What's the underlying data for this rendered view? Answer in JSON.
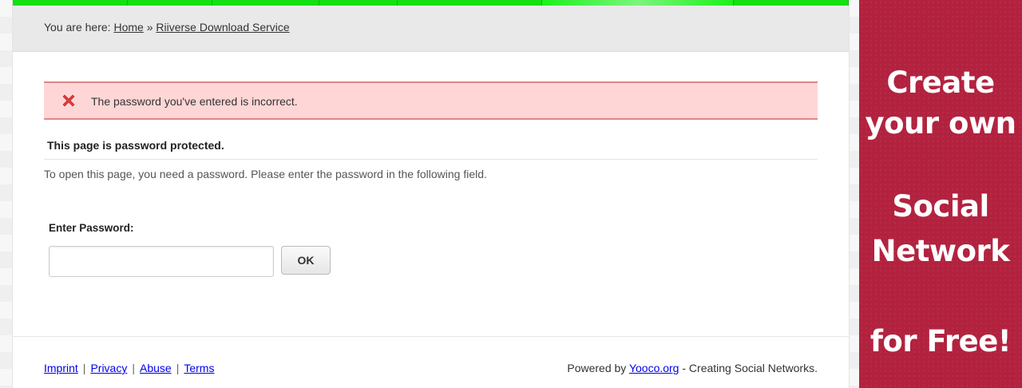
{
  "breadcrumb": {
    "prefix": "You are here: ",
    "home": "Home",
    "separator": " » ",
    "current": "Riiverse Download Service"
  },
  "alert": {
    "icon": "close-x-icon",
    "message": "The password you've entered is incorrect."
  },
  "protection": {
    "title": "This page is password protected.",
    "description": "To open this page, you need a password. Please enter the password in the following field."
  },
  "form": {
    "label": "Enter Password:",
    "password_value": "",
    "submit_label": "OK"
  },
  "footer": {
    "links": [
      "Imprint",
      "Privacy",
      "Abuse",
      "Terms"
    ],
    "separator": "|",
    "powered_prefix": "Powered by ",
    "powered_link": "Yooco.org",
    "powered_suffix": " - Creating Social Networks."
  },
  "ad": {
    "lines": [
      "Create",
      "your own",
      "Social",
      "Network",
      "for Free!"
    ]
  },
  "colors": {
    "nav_green": "#14e014",
    "alert_bg": "#ffd6d6",
    "ad_bg": "#b2223f"
  }
}
